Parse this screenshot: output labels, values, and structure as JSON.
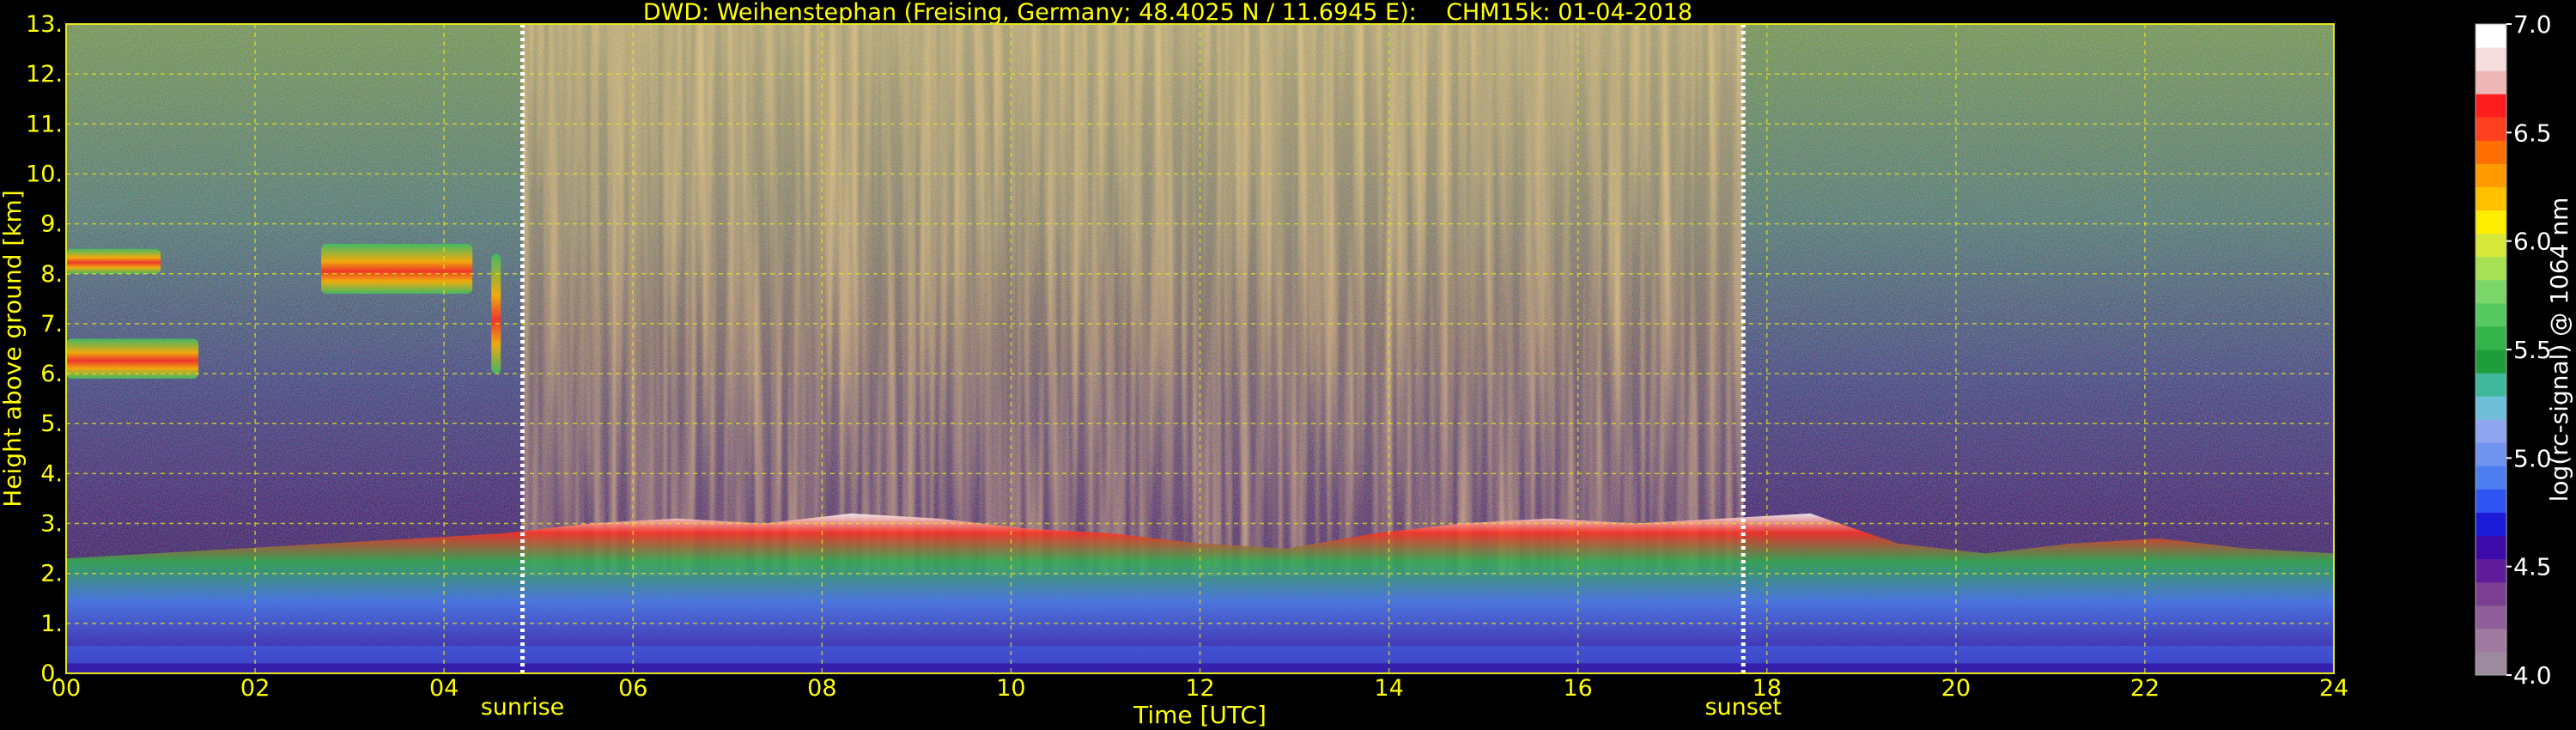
{
  "title": {
    "station": "DWD: Weihenstephan (Freising, Germany; 48.4025 N / 11.6945 E):",
    "instrument": "CHM15k: 01-04-2018"
  },
  "chart_data": {
    "type": "heatmap",
    "xlabel": "Time [UTC]",
    "ylabel": "Height above ground [km]",
    "xlim": [
      0,
      24
    ],
    "ylim": [
      0,
      13
    ],
    "x_ticks": [
      "00",
      "02",
      "04",
      "06",
      "08",
      "10",
      "12",
      "14",
      "16",
      "18",
      "20",
      "22",
      "24"
    ],
    "y_ticks": [
      "0.",
      "1.",
      "2.",
      "3.",
      "4.",
      "5.",
      "6.",
      "7.",
      "8.",
      "9.",
      "10.",
      "11.",
      "12.",
      "13."
    ],
    "grid": true,
    "annotations": [
      {
        "label": "sunrise",
        "x": 4.83
      },
      {
        "label": "sunset",
        "x": 17.75
      }
    ],
    "colorbar": {
      "label": "log(rc-signal) @ 1064 nm",
      "range": [
        4.0,
        7.0
      ],
      "ticks": [
        "4.0",
        "4.5",
        "5.0",
        "5.5",
        "6.0",
        "6.5",
        "7.0"
      ],
      "colors": [
        "#9d8a9f",
        "#a07aa0",
        "#8e5e98",
        "#7a3f92",
        "#5e1c9a",
        "#3c0aa8",
        "#1c1cd8",
        "#2e55f2",
        "#4c7ef0",
        "#6f93ef",
        "#8fa5ef",
        "#6fbfd8",
        "#3fb89a",
        "#1e9e3a",
        "#33b34a",
        "#55c860",
        "#7bd66a",
        "#a8e055",
        "#d8e83a",
        "#ffee00",
        "#ffc000",
        "#ff9a00",
        "#ff7000",
        "#ff4020",
        "#ff1e1e",
        "#eeb8b8",
        "#f6dede",
        "#ffffff"
      ]
    },
    "layers": {
      "boundary_layer_top_km": [
        2.3,
        2.4,
        2.5,
        2.6,
        2.7,
        2.8,
        3.0,
        3.1,
        3.0,
        3.2,
        3.1,
        2.9,
        2.8,
        2.6,
        2.5,
        2.8,
        3.0,
        3.1,
        3.0,
        3.1,
        3.2,
        2.6,
        2.4,
        2.6,
        2.7,
        2.5,
        2.4
      ],
      "cloud_layers": [
        {
          "start": 0.0,
          "end": 1.4,
          "base_km": 5.9,
          "top_km": 6.7
        },
        {
          "start": 0.0,
          "end": 1.0,
          "base_km": 8.0,
          "top_km": 8.5
        },
        {
          "start": 2.7,
          "end": 4.3,
          "base_km": 7.6,
          "top_km": 8.6
        },
        {
          "start": 4.5,
          "end": 4.6,
          "base_km": 6.0,
          "top_km": 8.4
        }
      ]
    }
  }
}
